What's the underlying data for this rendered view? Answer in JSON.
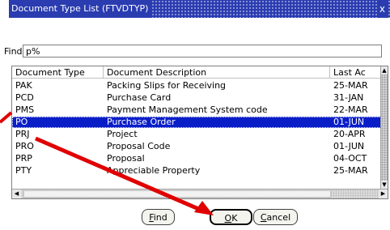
{
  "window": {
    "title": "Document Type List (FTVDTYP)",
    "close_glyph": "x"
  },
  "find": {
    "label": "Find",
    "value": "p%"
  },
  "table": {
    "columns": [
      "Document Type",
      "Document Description",
      "Last Ac"
    ],
    "rows": [
      {
        "type": "PAK",
        "desc": "Packing Slips for Receiving",
        "last": "25-MAR"
      },
      {
        "type": "PCD",
        "desc": "Purchase Card",
        "last": "31-JAN"
      },
      {
        "type": "PMS",
        "desc": "Payment Management System code",
        "last": "22-MAR"
      },
      {
        "type": "PO",
        "desc": "Purchase Order",
        "last": "01-JUN"
      },
      {
        "type": "PRJ",
        "desc": "Project",
        "last": "20-APR"
      },
      {
        "type": "PRO",
        "desc": "Proposal Code",
        "last": "01-JUN"
      },
      {
        "type": "PRP",
        "desc": "Proposal",
        "last": "04-OCT"
      },
      {
        "type": "PTY",
        "desc": "Appreciable Property",
        "last": "25-MAR"
      }
    ],
    "selected_row": 3
  },
  "buttons": {
    "find": {
      "accel": "F",
      "rest": "ind"
    },
    "ok": {
      "accel": "O",
      "rest": "K"
    },
    "cancel": {
      "accel": "C",
      "rest": "ancel"
    }
  },
  "colors": {
    "titlebar": "#2a3cb0",
    "selection": "#0a1ec8",
    "annotation_arrow": "#e00000"
  }
}
